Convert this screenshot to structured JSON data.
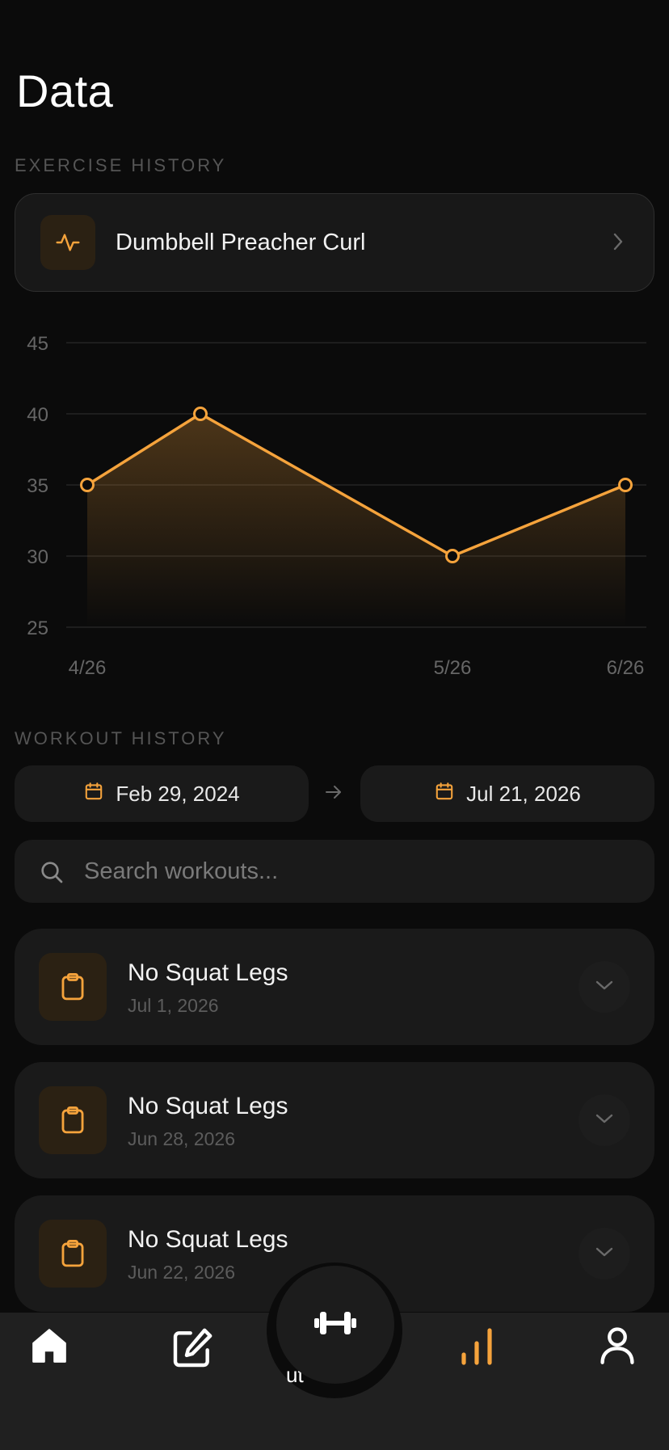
{
  "page": {
    "title": "Data"
  },
  "exercise_history": {
    "section_label": "EXERCISE HISTORY",
    "selected_exercise": "Dumbbell Preacher Curl",
    "exercise_icon": "activity-pulse-icon",
    "accent_color": "#f5a33c"
  },
  "chart_data": {
    "type": "area",
    "x": [
      "4/26",
      "",
      "5/26",
      "6/26"
    ],
    "xlabels": [
      "4/26",
      "5/26",
      "6/26"
    ],
    "values": [
      35,
      40,
      30,
      35
    ],
    "ylim": [
      25,
      45
    ],
    "yticks": [
      45,
      40,
      35,
      30,
      25
    ],
    "grid": true,
    "color": "#f5a33c"
  },
  "workout_history": {
    "section_label": "WORKOUT HISTORY",
    "start_date": "Feb 29, 2024",
    "end_date": "Jul 21, 2026",
    "search_placeholder": "Search workouts...",
    "items": [
      {
        "title": "No Squat Legs",
        "date": "Jul 1, 2026"
      },
      {
        "title": "No Squat Legs",
        "date": "Jun 28, 2026"
      },
      {
        "title": "No Squat Legs",
        "date": "Jun 22, 2026"
      }
    ]
  },
  "tabbar": {
    "items": [
      "home-icon",
      "edit-icon",
      "dumbbell-icon",
      "bar-chart-icon",
      "profile-icon"
    ],
    "active": "bar-chart-icon",
    "partial_label": "ut"
  }
}
